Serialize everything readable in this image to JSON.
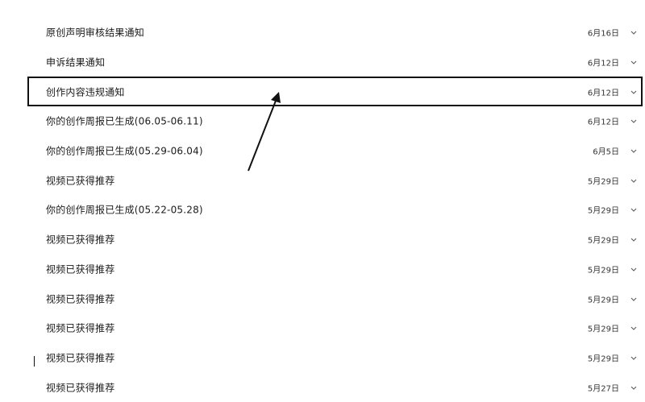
{
  "notifications": [
    {
      "title": "原创声明审核结果通知",
      "date": "6月16日"
    },
    {
      "title": "申诉结果通知",
      "date": "6月12日"
    },
    {
      "title": "创作内容违规通知",
      "date": "6月12日"
    },
    {
      "title": "你的创作周报已生成(06.05-06.11)",
      "date": "6月12日"
    },
    {
      "title": "你的创作周报已生成(05.29-06.04)",
      "date": "6月5日"
    },
    {
      "title": "视频已获得推荐",
      "date": "5月29日"
    },
    {
      "title": "你的创作周报已生成(05.22-05.28)",
      "date": "5月29日"
    },
    {
      "title": "视频已获得推荐",
      "date": "5月29日"
    },
    {
      "title": "视频已获得推荐",
      "date": "5月29日"
    },
    {
      "title": "视频已获得推荐",
      "date": "5月29日"
    },
    {
      "title": "视频已获得推荐",
      "date": "5月29日"
    },
    {
      "title": "视频已获得推荐",
      "date": "5月29日"
    },
    {
      "title": "视频已获得推荐",
      "date": "5月27日"
    }
  ],
  "icons": {
    "chevron": "chevron-down-icon",
    "annotation": "annotation-arrow-icon"
  },
  "colors": {
    "text": "#1a1a1a",
    "highlight_border": "#111111",
    "background": "#ffffff"
  }
}
